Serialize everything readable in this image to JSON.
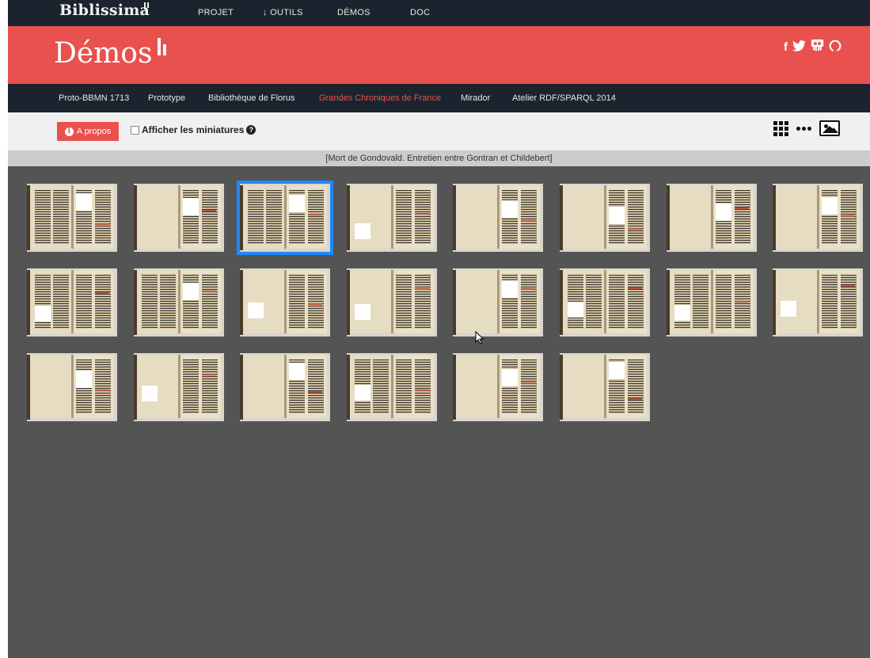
{
  "topnav": {
    "brand": "Biblissima",
    "items": [
      "PROJET",
      "↓ OUTILS",
      "DÉMOS",
      "DOC"
    ]
  },
  "banner": {
    "title": "Démos",
    "social_icons": [
      "facebook-icon",
      "twitter-icon",
      "slideshare-icon",
      "github-icon"
    ]
  },
  "subnav": {
    "items": [
      {
        "label": "Proto-BBMN 1713"
      },
      {
        "label": "Prototype"
      },
      {
        "label": "Bibliothèque de Florus"
      },
      {
        "label": "Grandes Chroniques de France"
      },
      {
        "label": "Mirador"
      },
      {
        "label": "Atelier RDF/SPARQL 2014"
      }
    ],
    "active_index": 3
  },
  "toolbar": {
    "about_label": "A propos",
    "thumbs_label": "Afficher les miniatures",
    "view_icons": [
      "grid-view-icon",
      "list-view-icon",
      "image-view-icon"
    ]
  },
  "caption": "[Mort de Gondovald. Entretien entre Gontran et Childebert]",
  "colors": {
    "brand_red": "#e8514e",
    "nav_dark": "#1b242e",
    "canvas_gray": "#545454",
    "selection_blue": "#1e88ff"
  },
  "thumbnails": {
    "rows": [
      8,
      8,
      6
    ],
    "selected_index": 2
  }
}
